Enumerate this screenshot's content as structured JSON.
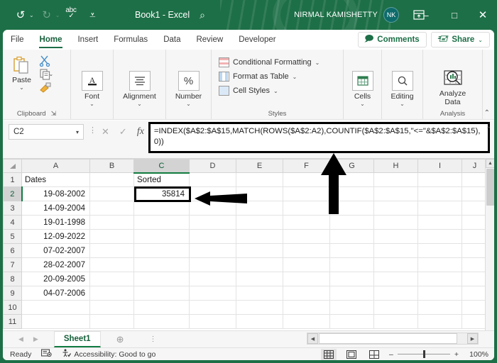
{
  "titlebar": {
    "undo_icon": "undo-icon",
    "redo_icon": "redo-icon",
    "spellcheck_icon": "spellcheck-icon",
    "customize_icon": "customize-quick-access-icon",
    "document_title": "Book1  -  Excel",
    "search_icon": "search-icon",
    "user_name": "NIRMAL KAMISHETTY",
    "user_initials": "NK",
    "ribbon_display_icon": "ribbon-display-options-icon",
    "minimize": "–",
    "maximize": "□",
    "close": "✕"
  },
  "tabs": [
    {
      "label": "File",
      "active": false
    },
    {
      "label": "Home",
      "active": true
    },
    {
      "label": "Insert",
      "active": false
    },
    {
      "label": "Formulas",
      "active": false
    },
    {
      "label": "Data",
      "active": false
    },
    {
      "label": "Review",
      "active": false
    },
    {
      "label": "Developer",
      "active": false
    }
  ],
  "tab_right": {
    "comments_label": "Comments",
    "comments_icon": "comment-icon",
    "share_label": "Share",
    "share_icon": "share-icon",
    "share_caret": "⌄"
  },
  "ribbon": {
    "groups": [
      {
        "name": "Clipboard",
        "label": "Clipboard"
      },
      {
        "name": "Font",
        "label": ""
      },
      {
        "name": "Alignment",
        "label": ""
      },
      {
        "name": "Number",
        "label": ""
      },
      {
        "name": "Styles",
        "label": "Styles"
      },
      {
        "name": "Cells",
        "label": ""
      },
      {
        "name": "Editing",
        "label": ""
      },
      {
        "name": "Analysis",
        "label": "Analysis"
      }
    ],
    "clipboard": {
      "paste_label": "Paste",
      "paste_icon": "paste-icon",
      "cut_icon": "cut-scissors-icon",
      "copy_icon": "copy-icon",
      "format_painter_icon": "format-painter-icon",
      "group_label": "Clipboard",
      "dialog_launcher_icon": "dialog-launcher-icon"
    },
    "font": {
      "label": "Font",
      "icon": "font-A-icon",
      "caret": "⌄"
    },
    "alignment": {
      "label": "Alignment",
      "icon": "alignment-lines-icon",
      "caret": "⌄"
    },
    "number": {
      "label": "Number",
      "icon": "percent-icon",
      "caret": "⌄"
    },
    "styles": {
      "conditional_formatting": "Conditional Formatting",
      "format_as_table": "Format as Table",
      "cell_styles": "Cell Styles",
      "caret": "⌄",
      "group_label": "Styles"
    },
    "cells": {
      "label": "Cells",
      "icon": "cells-table-icon",
      "caret": "⌄"
    },
    "editing": {
      "label": "Editing",
      "icon": "editing-magnifier-icon",
      "caret": "⌄"
    },
    "analysis": {
      "label_line1": "Analyze",
      "label_line2": "Data",
      "icon": "analyze-data-icon",
      "group_label": "Analysis"
    },
    "collapse_icon": "collapse-ribbon-chevron-icon"
  },
  "formula_bar": {
    "name_box_value": "C2",
    "name_box_caret": "▾",
    "more_icon": "name-box-more-icon",
    "cancel_icon": "cancel-x-icon",
    "enter_icon": "enter-check-icon",
    "insert_function_icon": "insert-function-fx-icon",
    "formula": "=INDEX($A$2:$A$15,MATCH(ROWS($A$2:A2),COUNTIF($A$2:$A$15,\"<=\"&$A$2:$A$15),0))",
    "expand_icon": "expand-formula-bar-icon"
  },
  "grid": {
    "columns": [
      "A",
      "B",
      "C",
      "D",
      "E",
      "F",
      "G",
      "H",
      "I",
      "J"
    ],
    "selected_column": "C",
    "selected_row": "2",
    "rows": [
      {
        "num": "1",
        "cells": {
          "A": "Dates",
          "C": "Sorted"
        }
      },
      {
        "num": "2",
        "cells": {
          "A": "19-08-2002",
          "C": "35814"
        }
      },
      {
        "num": "3",
        "cells": {
          "A": "14-09-2004",
          "C": ""
        }
      },
      {
        "num": "4",
        "cells": {
          "A": "19-01-1998",
          "C": ""
        }
      },
      {
        "num": "5",
        "cells": {
          "A": "12-09-2022",
          "C": ""
        }
      },
      {
        "num": "6",
        "cells": {
          "A": "07-02-2007",
          "C": ""
        }
      },
      {
        "num": "7",
        "cells": {
          "A": "28-02-2007",
          "C": ""
        }
      },
      {
        "num": "8",
        "cells": {
          "A": "20-09-2005",
          "C": ""
        }
      },
      {
        "num": "9",
        "cells": {
          "A": "04-07-2006",
          "C": ""
        }
      },
      {
        "num": "10",
        "cells": {
          "A": "",
          "C": ""
        }
      },
      {
        "num": "11",
        "cells": {
          "A": "",
          "C": ""
        }
      }
    ]
  },
  "annotations": {
    "arrow_to_cell": "left-pointing-arrow-annotation",
    "arrow_to_formula_bar": "up-pointing-arrow-annotation"
  },
  "sheetbar": {
    "prev_icon": "previous-sheet-icon",
    "next_icon": "next-sheet-icon",
    "sheet_name": "Sheet1",
    "add_sheet_icon": "add-sheet-icon",
    "scroll_left_icon": "scroll-left-icon",
    "scroll_right_icon": "scroll-right-icon"
  },
  "statusbar": {
    "state": "Ready",
    "macro_icon": "record-macro-icon",
    "accessibility_icon": "accessibility-icon",
    "accessibility": "Accessibility: Good to go",
    "view_normal_icon": "normal-view-icon",
    "view_page_layout_icon": "page-layout-view-icon",
    "view_page_break_icon": "page-break-preview-icon",
    "zoom_out": "–",
    "zoom_in": "+",
    "zoom_level": "100%"
  },
  "colors": {
    "brand_green": "#1d6f47",
    "accent_green": "#107c41",
    "selection_black": "#000000",
    "ribbon_bg": "#f6f6f6"
  }
}
